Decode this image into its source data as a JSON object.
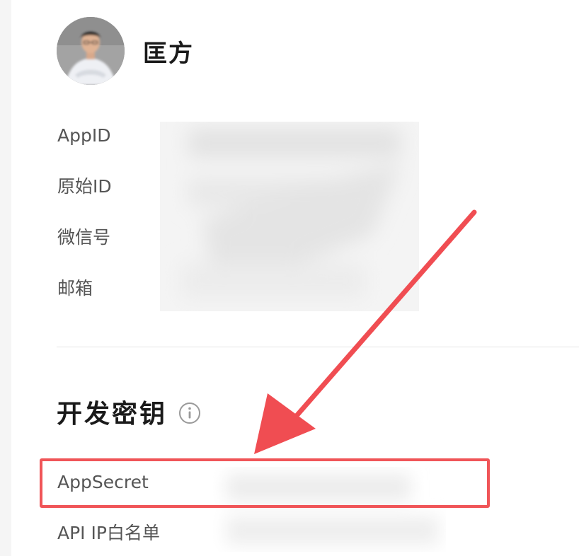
{
  "profile": {
    "name": "匡方"
  },
  "basic_info": {
    "labels": [
      "AppID",
      "原始ID",
      "微信号",
      "邮箱"
    ]
  },
  "dev_keys": {
    "title": "开发密钥",
    "appsecret_label": "AppSecret",
    "ip_whitelist_label": "API IP白名单"
  },
  "colors": {
    "highlight": "#f05558",
    "arrow": "#f04d52"
  },
  "icons": {
    "info": "info-circle-icon"
  }
}
